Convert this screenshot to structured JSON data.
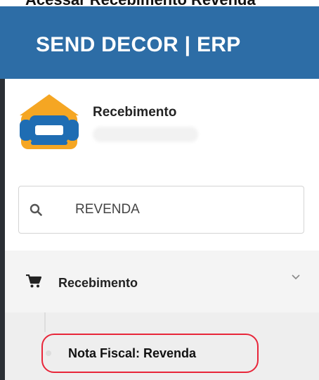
{
  "page_title": "Acessar Recebimento Revenda",
  "app": {
    "brand": "SEND DECOR | ERP",
    "header_color": "#2d6da6"
  },
  "profile": {
    "name": "Recebimento",
    "logo_icon": "sofa-house-logo-icon"
  },
  "search": {
    "value": "REVENDA",
    "icon": "search-icon"
  },
  "menu": {
    "section": {
      "label": "Recebimento",
      "icon": "cart-icon",
      "expanded": true
    },
    "items": [
      {
        "label": "Nota Fiscal: Revenda",
        "highlighted": true,
        "highlight_color": "#e8263a"
      }
    ]
  }
}
